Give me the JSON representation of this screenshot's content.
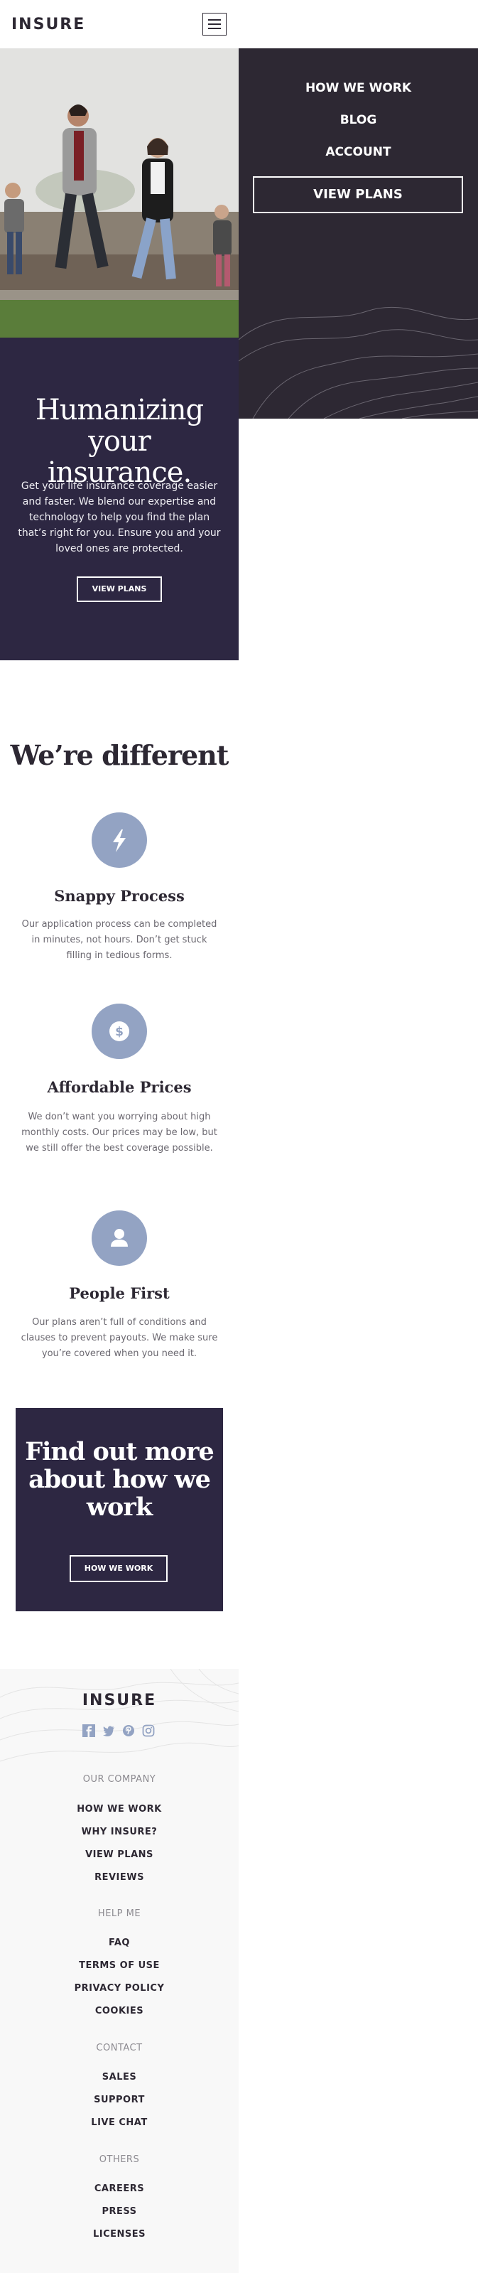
{
  "header": {
    "logo": "INSURE",
    "menu_icon": "hamburger-icon"
  },
  "nav": {
    "links": [
      "HOW WE WORK",
      "BLOG",
      "ACCOUNT"
    ],
    "cta": "VIEW PLANS"
  },
  "hero": {
    "title": "Humanizing your insurance.",
    "text": "Get your life insurance coverage easier and faster. We blend our expertise and technology to help you find the plan that’s right for you. Ensure you and your loved ones are protected.",
    "button": "VIEW PLANS"
  },
  "different": {
    "title": "We’re different",
    "features": [
      {
        "icon": "lightning-icon",
        "title": "Snappy Process",
        "text": "Our application process can be completed in minutes, not hours. Don’t get stuck filling in tedious forms."
      },
      {
        "icon": "dollar-icon",
        "title": "Affordable Prices",
        "text": "We don’t want you worrying about high monthly costs. Our prices may be low, but we still offer the best coverage possible."
      },
      {
        "icon": "person-icon",
        "title": "People First",
        "text": "Our plans aren’t full of conditions and clauses to prevent payouts. We make sure you’re covered when you need it."
      }
    ]
  },
  "cta": {
    "title": "Find out more about how we work",
    "button": "HOW WE WORK"
  },
  "footer": {
    "logo": "INSURE",
    "social_icons": [
      "facebook-icon",
      "twitter-icon",
      "pinterest-icon",
      "instagram-icon"
    ],
    "groups": [
      {
        "heading": "OUR COMPANY",
        "links": [
          "HOW WE WORK",
          "WHY INSURE?",
          "VIEW PLANS",
          "REVIEWS"
        ]
      },
      {
        "heading": "HELP ME",
        "links": [
          "FAQ",
          "TERMS OF USE",
          "PRIVACY POLICY",
          "COOKIES"
        ]
      },
      {
        "heading": "CONTACT",
        "links": [
          "SALES",
          "SUPPORT",
          "LIVE CHAT"
        ]
      },
      {
        "heading": "OTHERS",
        "links": [
          "CAREERS",
          "PRESS",
          "LICENSES"
        ]
      }
    ]
  },
  "colors": {
    "dark_violet": "#2d2742",
    "dark_grey": "#2d2833",
    "icon_blue": "#93a3c3",
    "footer_bg": "#f8f8f8"
  }
}
